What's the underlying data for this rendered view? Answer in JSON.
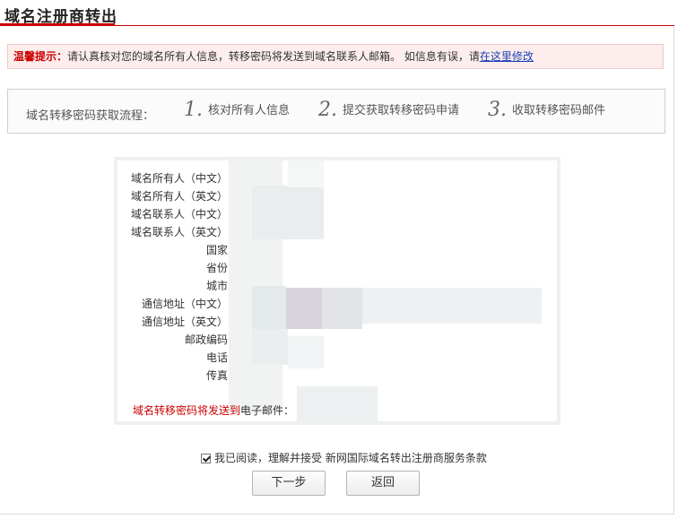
{
  "page": {
    "title": "域名注册商转出"
  },
  "notice": {
    "label": "温馨提示：",
    "text": "请认真核对您的域名所有人信息，转移密码将发送到域名联系人邮箱。 如信息有误，请",
    "link": "在这里修改"
  },
  "steps": {
    "label": "域名转移密码获取流程：",
    "items": [
      {
        "num": "1.",
        "text": "核对所有人信息"
      },
      {
        "num": "2.",
        "text": "提交获取转移密码申请"
      },
      {
        "num": "3.",
        "text": "收取转移密码邮件"
      }
    ]
  },
  "info": {
    "fields": [
      "域名所有人（中文）",
      "域名所有人（英文）",
      "域名联系人（中文）",
      "域名联系人（英文）",
      "国家",
      "省份",
      "城市",
      "通信地址（中文）",
      "通信地址（英文）",
      "邮政编码",
      "电话",
      "传真"
    ],
    "email_red": "域名转移密码将发送到",
    "email_label": "电子邮件："
  },
  "agreement": {
    "text": "我已阅读，理解并接受 新网国际域名转出注册商服务条款"
  },
  "buttons": {
    "next": "下一步",
    "back": "返回"
  }
}
